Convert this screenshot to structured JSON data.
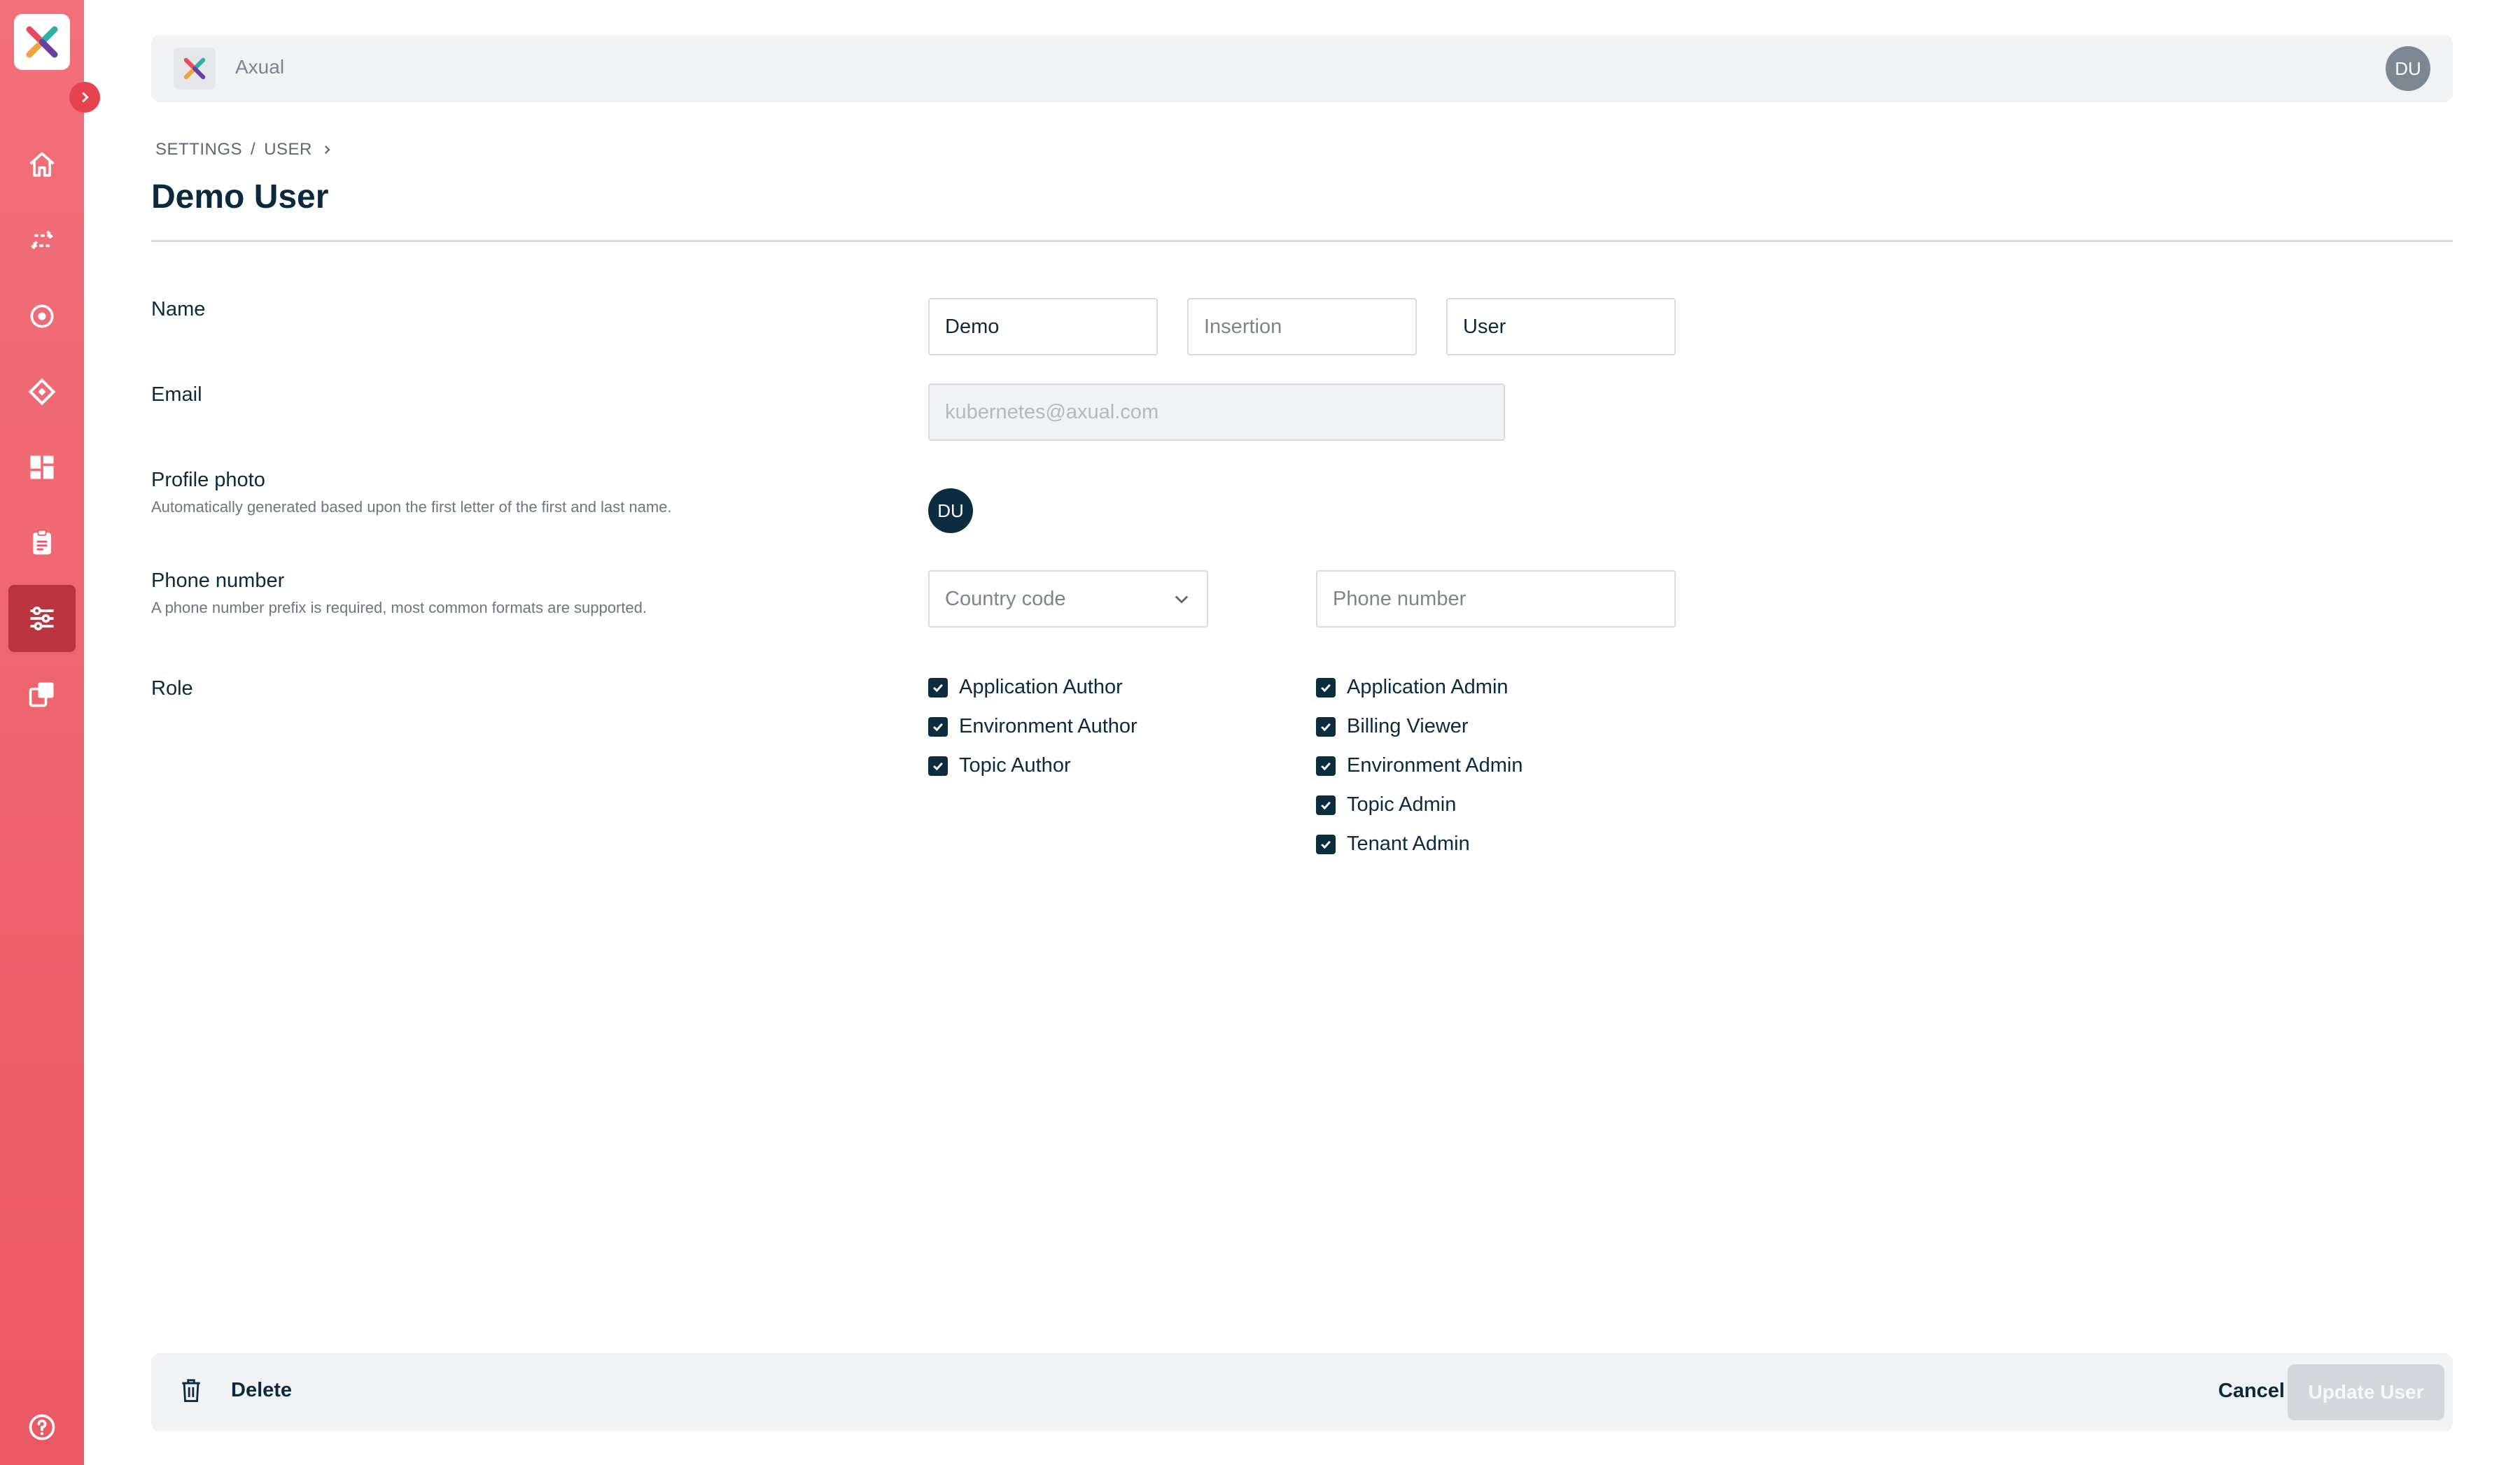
{
  "app": {
    "brand": "Axual",
    "user_initials": "DU"
  },
  "breadcrumb": {
    "items": [
      "SETTINGS",
      "USER"
    ],
    "separator": "/"
  },
  "page": {
    "title": "Demo User"
  },
  "form": {
    "name": {
      "label": "Name",
      "first": {
        "value": "Demo",
        "placeholder": ""
      },
      "insertion": {
        "value": "",
        "placeholder": "Insertion"
      },
      "last": {
        "value": "User",
        "placeholder": ""
      }
    },
    "email": {
      "label": "Email",
      "value": "kubernetes@axual.com"
    },
    "profile_photo": {
      "label": "Profile photo",
      "help": "Automatically generated based upon the first letter of the first and last name.",
      "initials": "DU"
    },
    "phone": {
      "label": "Phone number",
      "help": "A phone number prefix is required, most common formats are supported.",
      "country_placeholder": "Country code",
      "number_placeholder": "Phone number"
    },
    "role": {
      "label": "Role",
      "left": [
        {
          "label": "Application Author",
          "checked": true
        },
        {
          "label": "Environment Author",
          "checked": true
        },
        {
          "label": "Topic Author",
          "checked": true
        }
      ],
      "right": [
        {
          "label": "Application Admin",
          "checked": true
        },
        {
          "label": "Billing Viewer",
          "checked": true
        },
        {
          "label": "Environment Admin",
          "checked": true
        },
        {
          "label": "Topic Admin",
          "checked": true
        },
        {
          "label": "Tenant Admin",
          "checked": true
        }
      ]
    }
  },
  "footer": {
    "delete_label": "Delete",
    "cancel_label": "Cancel",
    "update_label": "Update User"
  },
  "colors": {
    "sidebar": "#ea5963",
    "sidebar_active": "#b93540",
    "dark_navy": "#0c2d40",
    "panel": "#f1f2f4"
  }
}
